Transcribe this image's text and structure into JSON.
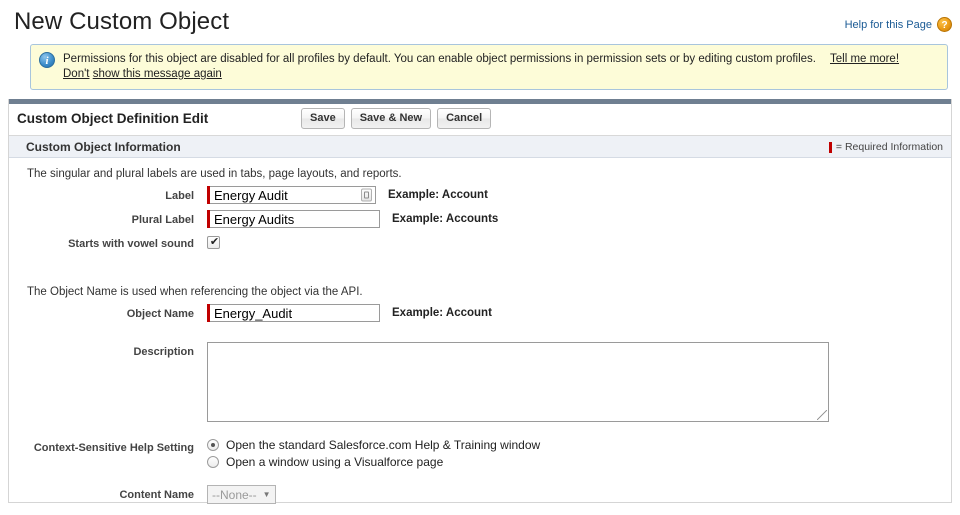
{
  "header": {
    "title": "New Custom Object",
    "help_link": "Help for this Page",
    "help_icon_glyph": "?",
    "help_icon_name": "help-question-icon"
  },
  "banner": {
    "info_icon_glyph": "i",
    "message": "Permissions for this object are disabled for all profiles by default. You can enable object permissions in permission sets or by editing custom profiles.",
    "link_tell_me_more": "Tell me more!",
    "link_dont_show_part1": "Don't",
    "link_dont_show_part2": "show this message again",
    "background_color": "#fdfcd8",
    "border_color": "#a8c5dd"
  },
  "toolbar": {
    "title": "Custom Object Definition Edit",
    "save_label": "Save",
    "save_new_label": "Save & New",
    "cancel_label": "Cancel"
  },
  "section": {
    "title": "Custom Object Information",
    "required_legend": "= Required Information",
    "required_color": "#c00000"
  },
  "form": {
    "helper_labels": "The singular and plural labels are used in tabs, page layouts, and reports.",
    "helper_objectname": "The Object Name is used when referencing the object via the API.",
    "label_field": {
      "label": "Label",
      "value": "Energy Audit",
      "example": "Example:  Account"
    },
    "plural_label_field": {
      "label": "Plural Label",
      "value": "Energy Audits",
      "example": "Example:  Accounts"
    },
    "vowel_field": {
      "label": "Starts with vowel sound",
      "checked": true
    },
    "object_name_field": {
      "label": "Object Name",
      "value": "Energy_Audit",
      "example": "Example:  Account"
    },
    "description_field": {
      "label": "Description",
      "value": ""
    },
    "help_setting_field": {
      "label": "Context-Sensitive Help Setting",
      "option_standard": "Open the standard Salesforce.com Help & Training window",
      "option_visualforce": "Open a window using a Visualforce page",
      "selected": "standard"
    },
    "content_name_field": {
      "label": "Content Name",
      "value": "--None--",
      "caret": "▼",
      "disabled": true
    }
  }
}
